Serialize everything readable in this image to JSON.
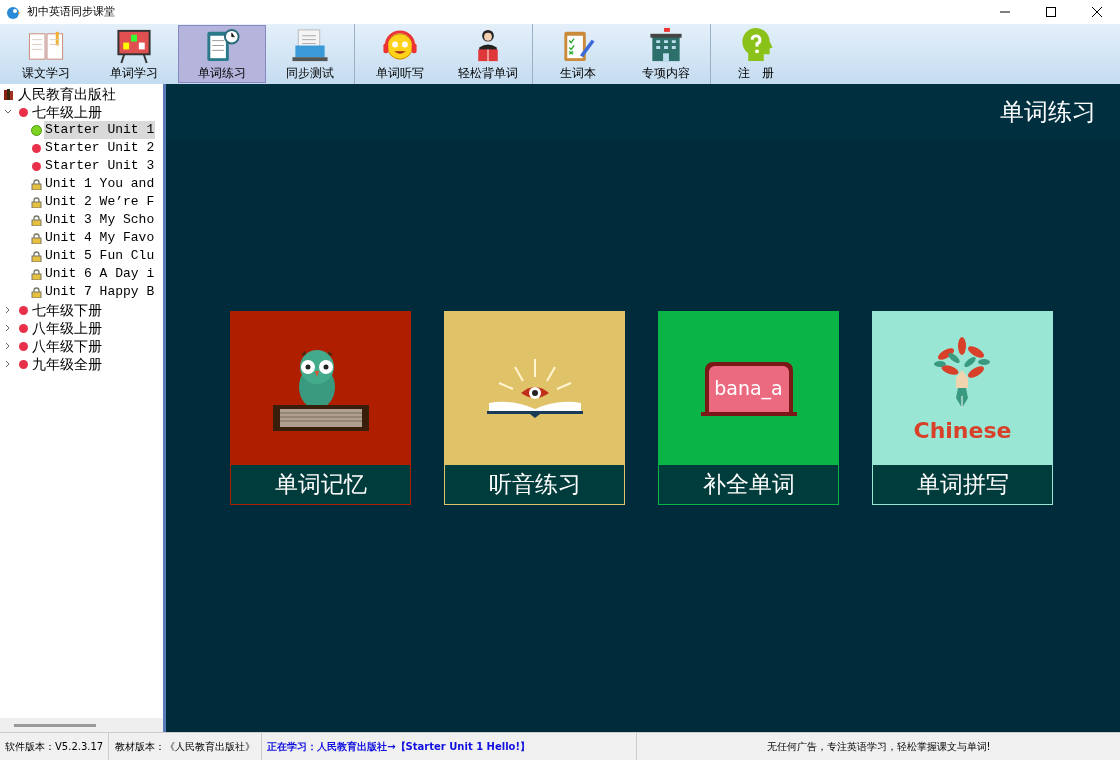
{
  "window": {
    "title": "初中英语同步课堂"
  },
  "toolbar": {
    "groups": [
      [
        {
          "label": "课文学习",
          "selected": false
        },
        {
          "label": "单词学习",
          "selected": false
        },
        {
          "label": "单词练习",
          "selected": true
        },
        {
          "label": "同步测试",
          "selected": false
        }
      ],
      [
        {
          "label": "单词听写",
          "selected": false
        },
        {
          "label": "轻松背单词",
          "selected": false
        }
      ],
      [
        {
          "label": "生词本",
          "selected": false
        },
        {
          "label": "专项内容",
          "selected": false
        }
      ],
      [
        {
          "label": "注　册",
          "selected": false
        }
      ]
    ]
  },
  "tree": {
    "root": "人民教育出版社",
    "children": [
      {
        "label": "七年级上册",
        "expanded": true,
        "children": [
          {
            "label": "Starter Unit 1",
            "kind": "current",
            "selected": true
          },
          {
            "label": "Starter Unit 2",
            "kind": "open",
            "selected": false
          },
          {
            "label": "Starter Unit 3",
            "kind": "open",
            "selected": false
          },
          {
            "label": "Unit 1 You and",
            "kind": "locked",
            "selected": false
          },
          {
            "label": "Unit 2 We’re F",
            "kind": "locked",
            "selected": false
          },
          {
            "label": "Unit 3 My Scho",
            "kind": "locked",
            "selected": false
          },
          {
            "label": "Unit 4 My Favo",
            "kind": "locked",
            "selected": false
          },
          {
            "label": "Unit 5 Fun Clu",
            "kind": "locked",
            "selected": false
          },
          {
            "label": "Unit 6 A Day i",
            "kind": "locked",
            "selected": false
          },
          {
            "label": "Unit 7 Happy B",
            "kind": "locked",
            "selected": false
          }
        ]
      },
      {
        "label": "七年级下册",
        "expanded": false
      },
      {
        "label": "八年级上册",
        "expanded": false
      },
      {
        "label": "八年级下册",
        "expanded": false
      },
      {
        "label": "九年级全册",
        "expanded": false
      }
    ]
  },
  "main": {
    "title": "单词练习",
    "cards": [
      {
        "label": "单词记忆",
        "kind": "owl",
        "color": "#b01e00"
      },
      {
        "label": "听音练习",
        "kind": "eye",
        "color": "#e0c268"
      },
      {
        "label": "补全单词",
        "kind": "blank",
        "color": "#0ab446",
        "art_text": "bana_a"
      },
      {
        "label": "单词拼写",
        "kind": "pen",
        "color": "#9ae6d4",
        "art_text": "Chinese"
      }
    ]
  },
  "status_bar": {
    "software_version": "软件版本：V5.2.3.17",
    "textbook_version": "教材版本：《人民教育出版社》",
    "studying": "正在学习：人民教育出版社→【Starter Unit 1 Hello!】",
    "slogan": "无任何广告，专注英语学习，轻松掌握课文与单词!"
  }
}
